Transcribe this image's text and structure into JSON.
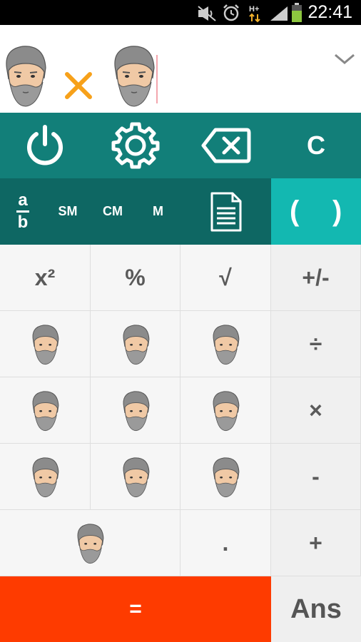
{
  "status_bar": {
    "time": "22:41",
    "network": "H+",
    "icons": [
      "mute-icon",
      "alarm-icon",
      "network-hplus-icon",
      "signal-icon",
      "battery-icon"
    ]
  },
  "display": {
    "expression_tokens": [
      "hodor-face-icon",
      "multiply-icon",
      "hodor-face-icon"
    ],
    "operator_color": "#f7a11a",
    "collapse_icon": "chevron-down-icon"
  },
  "top_controls": {
    "power_icon": "power-icon",
    "settings_icon": "gear-icon",
    "backspace_icon": "backspace-icon",
    "clear_label": "C"
  },
  "memory_row": {
    "fraction_top": "a",
    "fraction_bottom": "b",
    "sm_label": "SM",
    "cm_label": "CM",
    "m_label": "M",
    "history_icon": "document-icon",
    "open_paren": "(",
    "close_paren": ")"
  },
  "keypad": {
    "square_label": "x²",
    "percent_label": "%",
    "sqrt_label": "√",
    "sign_label": "+/-",
    "divide_label": "÷",
    "multiply_label": "×",
    "minus_label": "-",
    "plus_label": "+",
    "dot_label": ".",
    "digit_key_icon": "hodor-face-icon",
    "equals_label": "=",
    "ans_label": "Ans"
  },
  "colors": {
    "row1_bg": "#127f79",
    "row2_bg": "#0e6763",
    "paren_bg": "#13b8b1",
    "equals_bg": "#fe3b00",
    "keypad_bg": "#f6f6f6"
  }
}
